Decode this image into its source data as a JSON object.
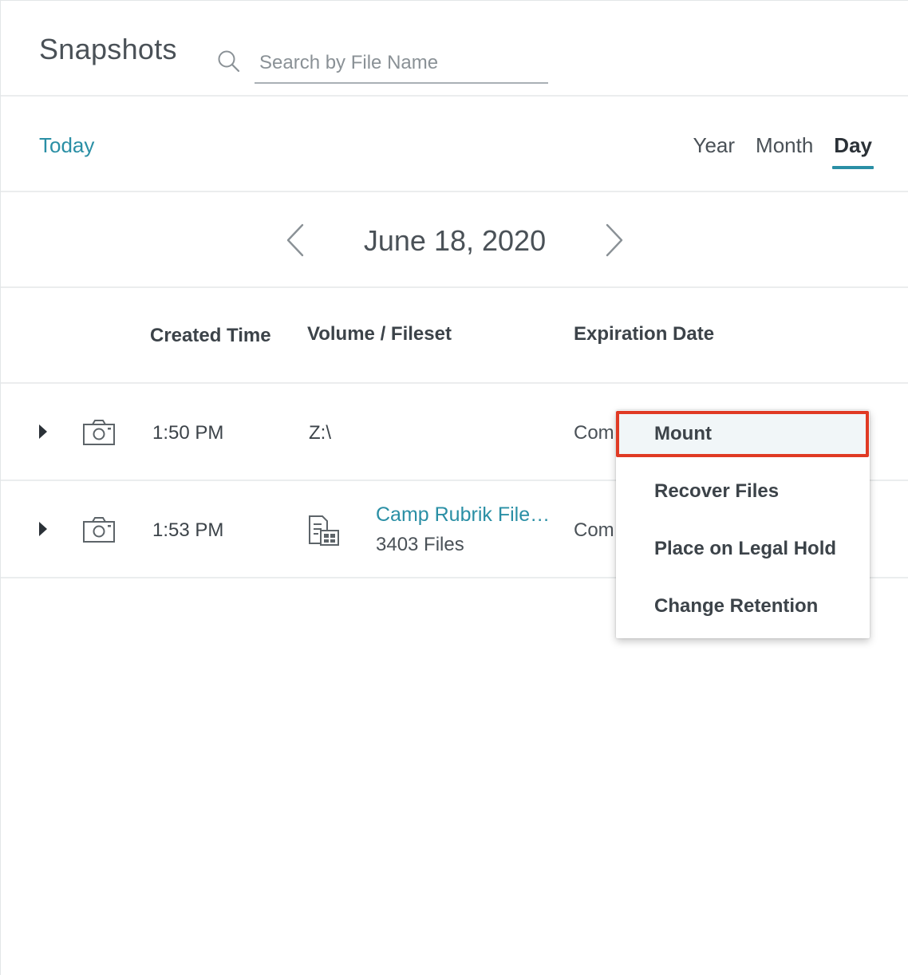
{
  "header": {
    "title": "Snapshots",
    "search": {
      "placeholder": "Search by File Name",
      "value": ""
    }
  },
  "range": {
    "today_label": "Today",
    "tabs": [
      {
        "label": "Year",
        "active": false
      },
      {
        "label": "Month",
        "active": false
      },
      {
        "label": "Day",
        "active": true
      }
    ]
  },
  "date_nav": {
    "current_date": "June 18, 2020"
  },
  "table": {
    "columns": [
      "Created Time",
      "Volume / Fileset",
      "Expiration Date"
    ],
    "rows": [
      {
        "time": "1:50 PM",
        "volume": "Z:\\",
        "expiration_truncated": "Com"
      },
      {
        "time": "1:53 PM",
        "fileset_name": "Camp Rubrik File…",
        "file_count": "3403 Files",
        "expiration_truncated": "Com"
      }
    ]
  },
  "context_menu": {
    "items": [
      "Mount",
      "Recover Files",
      "Place on Legal Hold",
      "Change Retention"
    ],
    "highlighted": "Mount"
  },
  "colors": {
    "accent": "#2a8fa5",
    "highlight_border": "#e03a24",
    "text": "#3c4349"
  }
}
